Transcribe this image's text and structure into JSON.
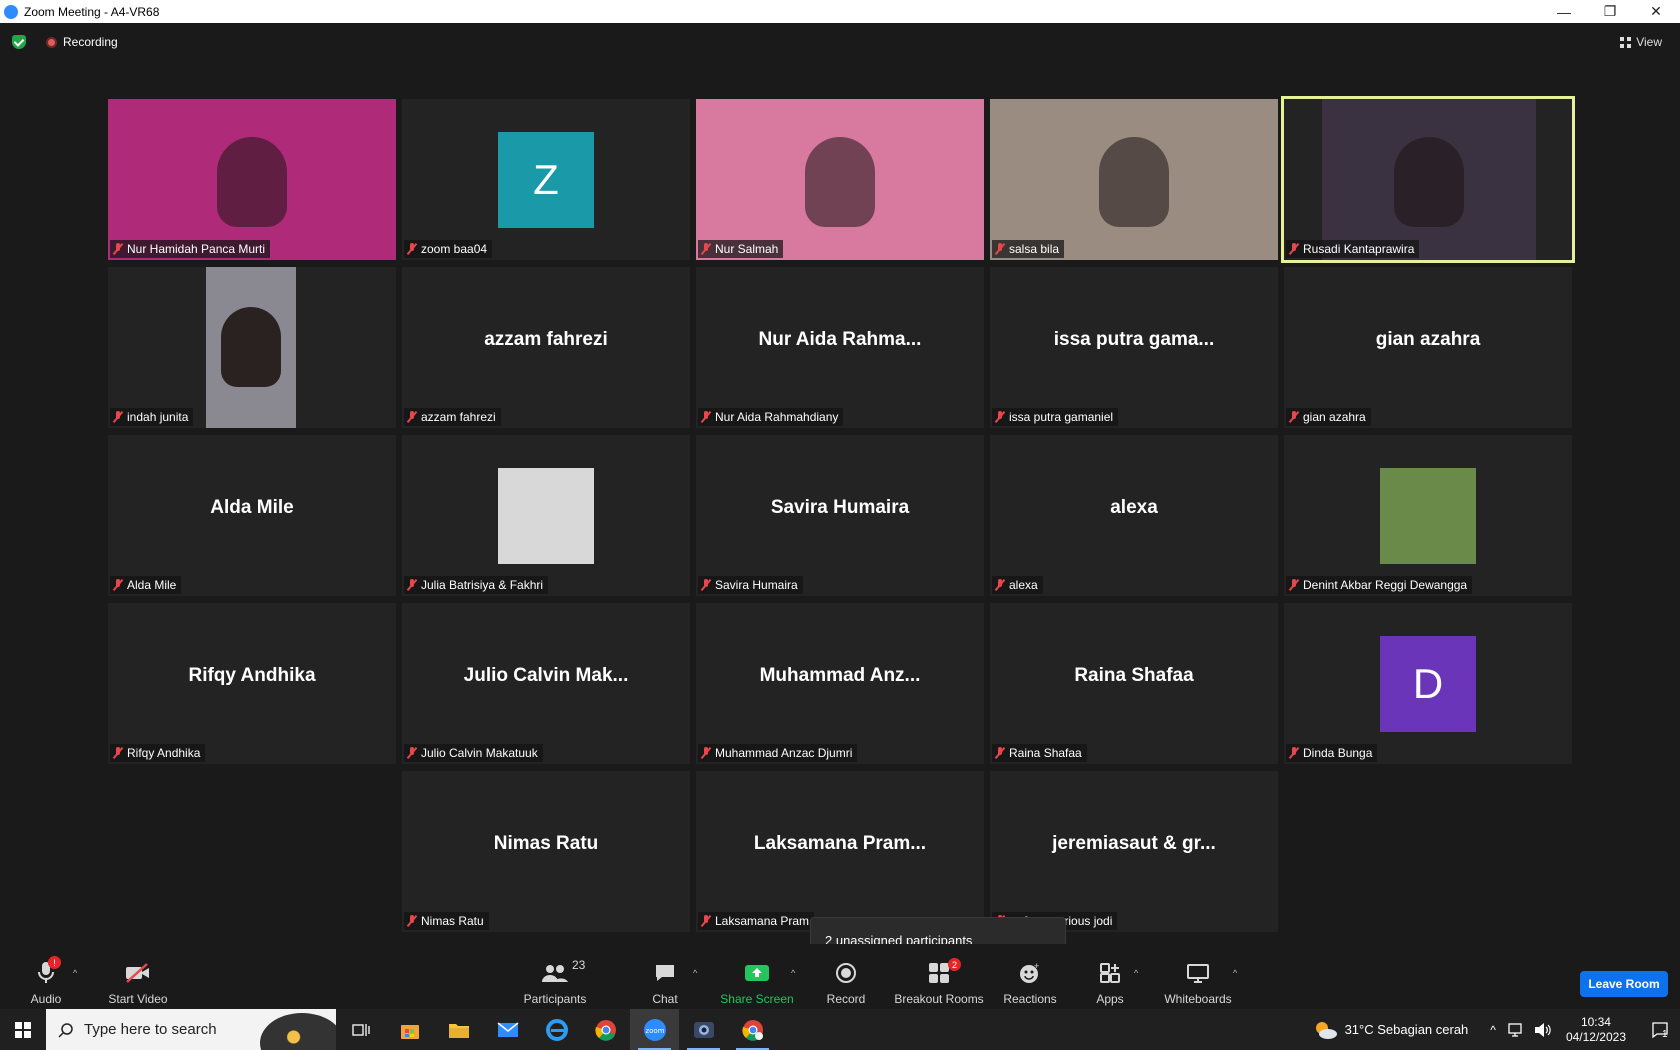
{
  "window": {
    "title": "Zoom Meeting - A4-VR68",
    "min_icon": "minimize-icon",
    "restore_icon": "restore-icon",
    "close_icon": "close-icon"
  },
  "meeting": {
    "recording_label": "Recording",
    "view_label": "View",
    "tiles": [
      {
        "name": "Nur Hamidah Panca Murti",
        "kind": "video",
        "bg": "#b02a7a"
      },
      {
        "name": "zoom baa04",
        "kind": "letter",
        "letter": "Z",
        "color": "#1a9aa8"
      },
      {
        "name": "Nur Salmah",
        "kind": "video",
        "bg": "#d87aa0"
      },
      {
        "name": "salsa bila",
        "kind": "video",
        "bg": "#9a8c80"
      },
      {
        "name": "Rusadi Kantaprawira",
        "kind": "video",
        "bg": "#3a3240",
        "active": true
      },
      {
        "name": "indah junita",
        "kind": "video-narrow",
        "bg": "#8a8890"
      },
      {
        "name": "azzam fahrezi",
        "kind": "text",
        "display": "azzam fahrezi"
      },
      {
        "name": "Nur Aida Rahmahdiany",
        "kind": "text",
        "display": "Nur Aida Rahma..."
      },
      {
        "name": "issa putra gamaniel",
        "kind": "text",
        "display": "issa putra gama..."
      },
      {
        "name": "gian azahra",
        "kind": "text",
        "display": "gian azahra"
      },
      {
        "name": "Alda Mile",
        "kind": "text",
        "display": "Alda Mile"
      },
      {
        "name": "Julia Batrisiya & Fakhri",
        "kind": "photo",
        "bg": "#d8d8d8"
      },
      {
        "name": "Savira Humaira",
        "kind": "text",
        "display": "Savira Humaira"
      },
      {
        "name": "alexa",
        "kind": "text",
        "display": "alexa"
      },
      {
        "name": "Denint Akbar Reggi Dewangga",
        "kind": "photo",
        "bg": "#6a8a4a"
      },
      {
        "name": "Rifqy Andhika",
        "kind": "text",
        "display": "Rifqy Andhika"
      },
      {
        "name": "Julio Calvin Makatuuk",
        "kind": "text",
        "display": "Julio Calvin Mak..."
      },
      {
        "name": "Muhammad Anzac Djumri",
        "kind": "text",
        "display": "Muhammad Anz..."
      },
      {
        "name": "Raina Shafaa",
        "kind": "text",
        "display": "Raina Shafaa"
      },
      {
        "name": "Dinda Bunga",
        "kind": "letter",
        "letter": "D",
        "color": "#6a35b8"
      },
      {
        "name": "Nimas Ratu",
        "kind": "text",
        "display": "Nimas Ratu"
      },
      {
        "name": "Laksamana Pram",
        "kind": "text",
        "display": "Laksamana Pram..."
      },
      {
        "name": "ut & gregorious jodi",
        "kind": "text",
        "display": "jeremiasaut & gr..."
      }
    ],
    "tooltip": "2 unassigned participants"
  },
  "toolbar": {
    "audio": {
      "label": "Audio",
      "badge": "!"
    },
    "video": {
      "label": "Start Video"
    },
    "participants": {
      "label": "Participants",
      "count": "23"
    },
    "chat": {
      "label": "Chat"
    },
    "share": {
      "label": "Share Screen"
    },
    "record": {
      "label": "Record"
    },
    "breakout": {
      "label": "Breakout Rooms",
      "badge": "2"
    },
    "reactions": {
      "label": "Reactions"
    },
    "apps": {
      "label": "Apps"
    },
    "whiteboards": {
      "label": "Whiteboards"
    },
    "leave": {
      "label": "Leave Room"
    }
  },
  "taskbar": {
    "search_placeholder": "Type here to search",
    "weather": "31°C  Sebagian cerah",
    "time": "10:34",
    "date": "04/12/2023",
    "notification_count": "1"
  },
  "colors": {
    "accent": "#0e72ed",
    "share_green": "#22c55e",
    "active_speaker": "#e6ef9a",
    "muted_red": "#e5484d"
  }
}
